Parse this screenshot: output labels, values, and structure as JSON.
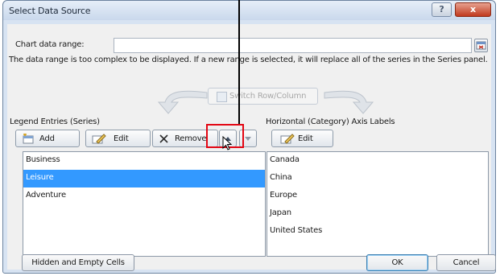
{
  "dialog": {
    "title": "Select Data Source",
    "help_label": "?",
    "close_label": "x"
  },
  "range": {
    "label": "Chart data range:",
    "value": ""
  },
  "message": "The data range is too complex to be displayed. If a new range is selected, it will replace all of the series in the Series panel.",
  "switch_label": "Switch Row/Column",
  "legend": {
    "heading": "Legend Entries (Series)",
    "add_label": "Add",
    "edit_label": "Edit",
    "remove_label": "Remove",
    "items": [
      "Business",
      "Leisure",
      "Adventure"
    ],
    "selected_index": 1
  },
  "axis": {
    "heading": "Horizontal (Category) Axis Labels",
    "edit_label": "Edit",
    "items": [
      "Canada",
      "China",
      "Europe",
      "Japan",
      "United States"
    ]
  },
  "footer": {
    "hidden_label": "Hidden and Empty Cells",
    "ok_label": "OK",
    "cancel_label": "Cancel"
  },
  "annotation_color": "#e30613"
}
